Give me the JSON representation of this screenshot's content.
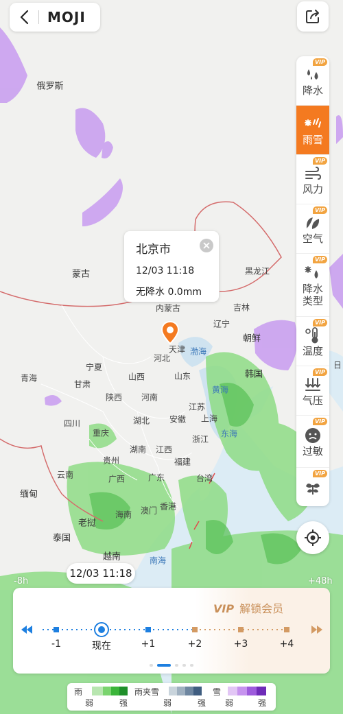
{
  "app": {
    "logo": "MOJI"
  },
  "map": {
    "labels": {
      "russia": "俄罗斯",
      "mongolia": "蒙古",
      "heilongjiang": "黑龙江",
      "jilin": "吉林",
      "liaoning": "辽宁",
      "inner_mongolia": "内蒙古",
      "tianjin": "天津",
      "bohai": "渤海",
      "hebei": "河北",
      "north_korea": "朝鲜",
      "south_korea": "韩国",
      "ningxia": "宁夏",
      "qinghai": "青海",
      "gansu": "甘肃",
      "shanxi": "山西",
      "shandong": "山东",
      "yellow_sea": "黄海",
      "shaanxi": "陕西",
      "henan": "河南",
      "jiangsu": "江苏",
      "sichuan": "四川",
      "chongqing": "重庆",
      "hubei": "湖北",
      "anhui": "安徽",
      "shanghai": "上海",
      "east_sea": "东海",
      "zhejiang": "浙江",
      "guizhou": "贵州",
      "hunan": "湖南",
      "jiangxi": "江西",
      "fujian": "福建",
      "yunnan": "云南",
      "guangxi": "广西",
      "guangdong": "广东",
      "taiwan": "台湾",
      "myanmar": "缅甸",
      "hainan": "海南",
      "macau": "澳门",
      "hongkong": "香港",
      "laos": "老挝",
      "thailand": "泰国",
      "vietnam": "越南",
      "south_china_sea": "南海",
      "japan_edge": "日"
    }
  },
  "layers": [
    {
      "label": "降水",
      "icon": "rain-drops-icon",
      "vip": "VIP",
      "active": false
    },
    {
      "label": "雨雪",
      "icon": "rain-snow-icon",
      "vip": "",
      "active": true
    },
    {
      "label": "风力",
      "icon": "wind-icon",
      "vip": "VIP",
      "active": false
    },
    {
      "label": "空气",
      "icon": "leaf-icon",
      "vip": "VIP",
      "active": false
    },
    {
      "label": "降水类型",
      "icon": "precip-type-icon",
      "vip": "VIP",
      "active": false
    },
    {
      "label": "温度",
      "icon": "thermometer-icon",
      "vip": "VIP",
      "active": false
    },
    {
      "label": "气压",
      "icon": "pressure-icon",
      "vip": "VIP",
      "active": false
    },
    {
      "label": "过敏",
      "icon": "allergy-face-icon",
      "vip": "VIP",
      "active": false
    },
    {
      "label": "",
      "icon": "plant-icon",
      "vip": "VIP",
      "active": false
    }
  ],
  "popup": {
    "city": "北京市",
    "time": "12/03 11:18",
    "precip": "无降水 0.0mm"
  },
  "timestamp_badge": "12/03 11:18",
  "edge_labels": {
    "left": "-8h",
    "right": "+48h"
  },
  "timeline": {
    "vip_tag": "VIP",
    "unlock": "解锁会员",
    "ticks": [
      "-1",
      "现在",
      "+1",
      "+2",
      "+3",
      "+4"
    ]
  },
  "legend": {
    "rain": "雨",
    "sleet": "雨夹雪",
    "snow": "雪",
    "weak": "弱",
    "strong": "强",
    "colors": {
      "rain": [
        "#b8e6b0",
        "#7ad46e",
        "#3bb53a",
        "#1f8f2a"
      ],
      "sleet": [
        "#c9d4dc",
        "#9fb0c0",
        "#6e86a0",
        "#3f5d80"
      ],
      "snow": [
        "#e2c6f5",
        "#c693ee",
        "#9d5bdc",
        "#6e2bb8"
      ]
    }
  }
}
